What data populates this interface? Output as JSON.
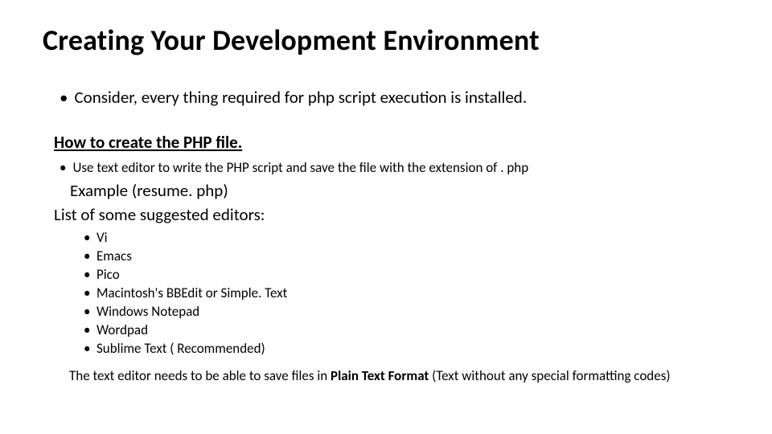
{
  "title": "Creating Your Development Environment",
  "bullet_main": "Consider, every thing required for php script execution is installed.",
  "sub_heading": "How to create the PHP file.",
  "bullet_sub": "Use text editor to write the PHP script and save the file with the extension of . php",
  "example": "Example (resume. php)",
  "list_label": "List of some suggested editors:",
  "editors": {
    "e0": "Vi",
    "e1": "Emacs",
    "e2": "Pico",
    "e3": "Macintosh's BBEdit or Simple. Text",
    "e4": "Windows Notepad",
    "e5": "Wordpad",
    "e6": "Sublime Text ( Recommended)"
  },
  "closing": {
    "pre": "The text editor needs to be able to save files in ",
    "bold": "Plain Text Format",
    "post": " (Text without any special formatting codes)"
  },
  "bullet_char": "•"
}
